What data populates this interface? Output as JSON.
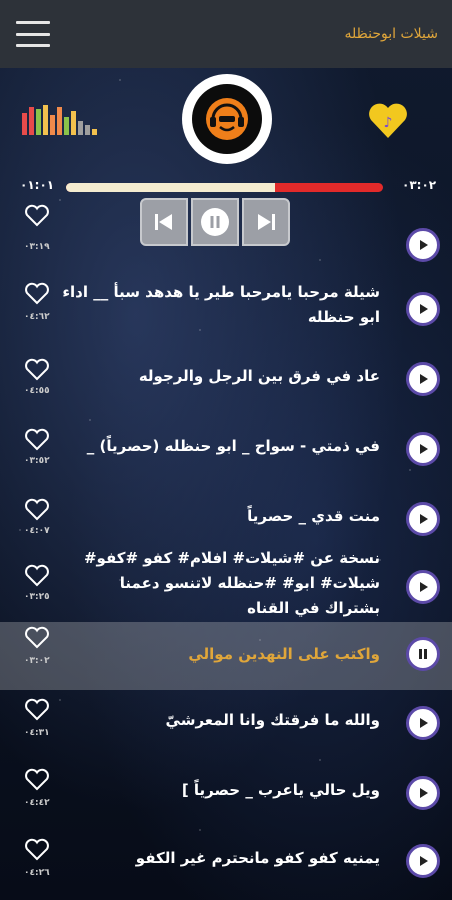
{
  "app": {
    "title": "شيلات ابوحنظله"
  },
  "player": {
    "elapsed": "٠١:٠١",
    "duration": "٠٣:٠٢",
    "progress": 0.66
  },
  "colors": {
    "accent": "#e0a63a",
    "play_ring": "#5c4aa8",
    "progress_fill": "#f4ecd0",
    "progress_rest": "#e22a2a"
  },
  "songs": [
    {
      "title": "",
      "duration": "٠٣:١٩",
      "active": false
    },
    {
      "title": "شيلة مرحبا يامرحبا طير يا هدهد سبأ __ اداء ابو حنظله",
      "duration": "٠٤:٦٢",
      "active": false
    },
    {
      "title": "عاد في فرق بين الرجل والرجوله",
      "duration": "٠٤:٥٥",
      "active": false
    },
    {
      "title": "في ذمتي - سواح _ ابو حنظله (حصرياً) _",
      "duration": "٠٣:٥٢",
      "active": false
    },
    {
      "title": "منت قدي _ حصرياً",
      "duration": "٠٤:٠٧",
      "active": false
    },
    {
      "title": "نسخة عن #شيلات# افلام# كفو #كفو# شيلات# ابو# #حنظله لاتنسو دعمنا بشتراك في القناه",
      "duration": "٠٣:٢٥",
      "active": false
    },
    {
      "title": "واكتب على النهدين موالي",
      "duration": "٠٣:٠٢",
      "active": true
    },
    {
      "title": "والله ما فرقتك وانا المعرشيّ",
      "duration": "٠٤:٣١",
      "active": false
    },
    {
      "title": "ويل حالي ياعرب _ حصرياً ]",
      "duration": "٠٤:٤٢",
      "active": false
    },
    {
      "title": "يمنيه كفو كفو مانحترم غير الكفو",
      "duration": "٠٤:٢٦",
      "active": false
    }
  ]
}
